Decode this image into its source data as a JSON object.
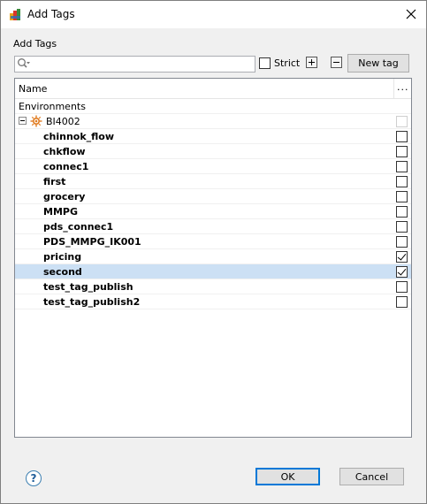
{
  "window": {
    "title": "Add Tags",
    "close_glyph": "✕"
  },
  "section_label": "Add Tags",
  "search": {
    "value": "",
    "placeholder": "",
    "icon": "search-icon"
  },
  "strict": {
    "label": "Strict",
    "checked": false
  },
  "toolbar": {
    "expand_all": "expand-all",
    "collapse_all": "collapse-all",
    "new_tag_label": "New tag"
  },
  "grid": {
    "columns": {
      "name": "Name",
      "more": "..."
    },
    "group_label": "Environments",
    "environment": {
      "name": "BI4002",
      "expanded": true
    },
    "tags": [
      {
        "name": "chinnok_flow",
        "checked": false,
        "selected": false
      },
      {
        "name": "chkflow",
        "checked": false,
        "selected": false
      },
      {
        "name": "connec1",
        "checked": false,
        "selected": false
      },
      {
        "name": "first",
        "checked": false,
        "selected": false
      },
      {
        "name": "grocery",
        "checked": false,
        "selected": false
      },
      {
        "name": "MMPG",
        "checked": false,
        "selected": false
      },
      {
        "name": "pds_connec1",
        "checked": false,
        "selected": false
      },
      {
        "name": "PDS_MMPG_IK001",
        "checked": false,
        "selected": false
      },
      {
        "name": "pricing",
        "checked": true,
        "selected": false
      },
      {
        "name": "second",
        "checked": true,
        "selected": true
      },
      {
        "name": "test_tag_publish",
        "checked": false,
        "selected": false
      },
      {
        "name": "test_tag_publish2",
        "checked": false,
        "selected": false
      }
    ]
  },
  "footer": {
    "help_glyph": "?",
    "ok_label": "OK",
    "cancel_label": "Cancel"
  },
  "colors": {
    "selection": "#cce0f4",
    "accent": "#0078d7"
  }
}
